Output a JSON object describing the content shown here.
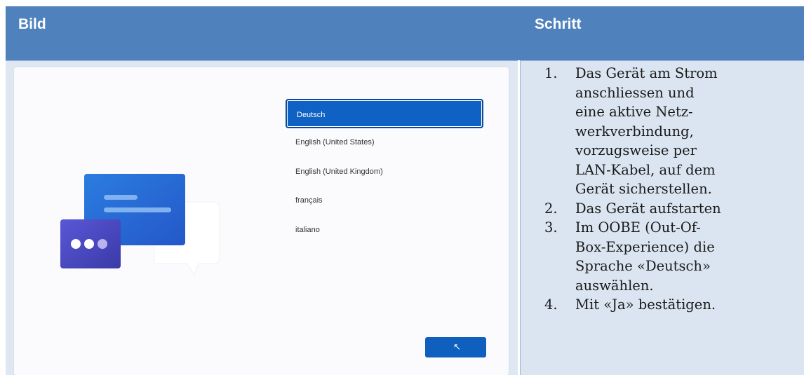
{
  "table": {
    "headers": {
      "image": "Bild",
      "step": "Schritt"
    },
    "screen": {
      "languages": [
        {
          "label": "Deutsch",
          "selected": true
        },
        {
          "label": "English (United States)",
          "selected": false
        },
        {
          "label": "English (United Kingdom)",
          "selected": false
        },
        {
          "label": "français",
          "selected": false
        },
        {
          "label": "italiano",
          "selected": false
        }
      ],
      "next_button_label": ""
    },
    "steps": [
      {
        "num": "1.",
        "text": "Das Gerät am Strom\nanschliessen und\neine aktive Netz-\nwerkverbindung,\nvorzugsweise per\nLAN-Kabel, auf dem\nGerät sicherstellen."
      },
      {
        "num": "2.",
        "text": "Das Gerät aufstarten"
      },
      {
        "num": "3.",
        "text": "Im OOBE (Out-Of-\nBox-Experience) die\nSprache «Deutsch»\nauswählen."
      },
      {
        "num": "4.",
        "text": "Mit «Ja» bestätigen."
      }
    ]
  },
  "colors": {
    "header_bg": "#4f81bd",
    "cell_bg": "#dbe5f1",
    "accent_blue": "#0f62c4"
  }
}
